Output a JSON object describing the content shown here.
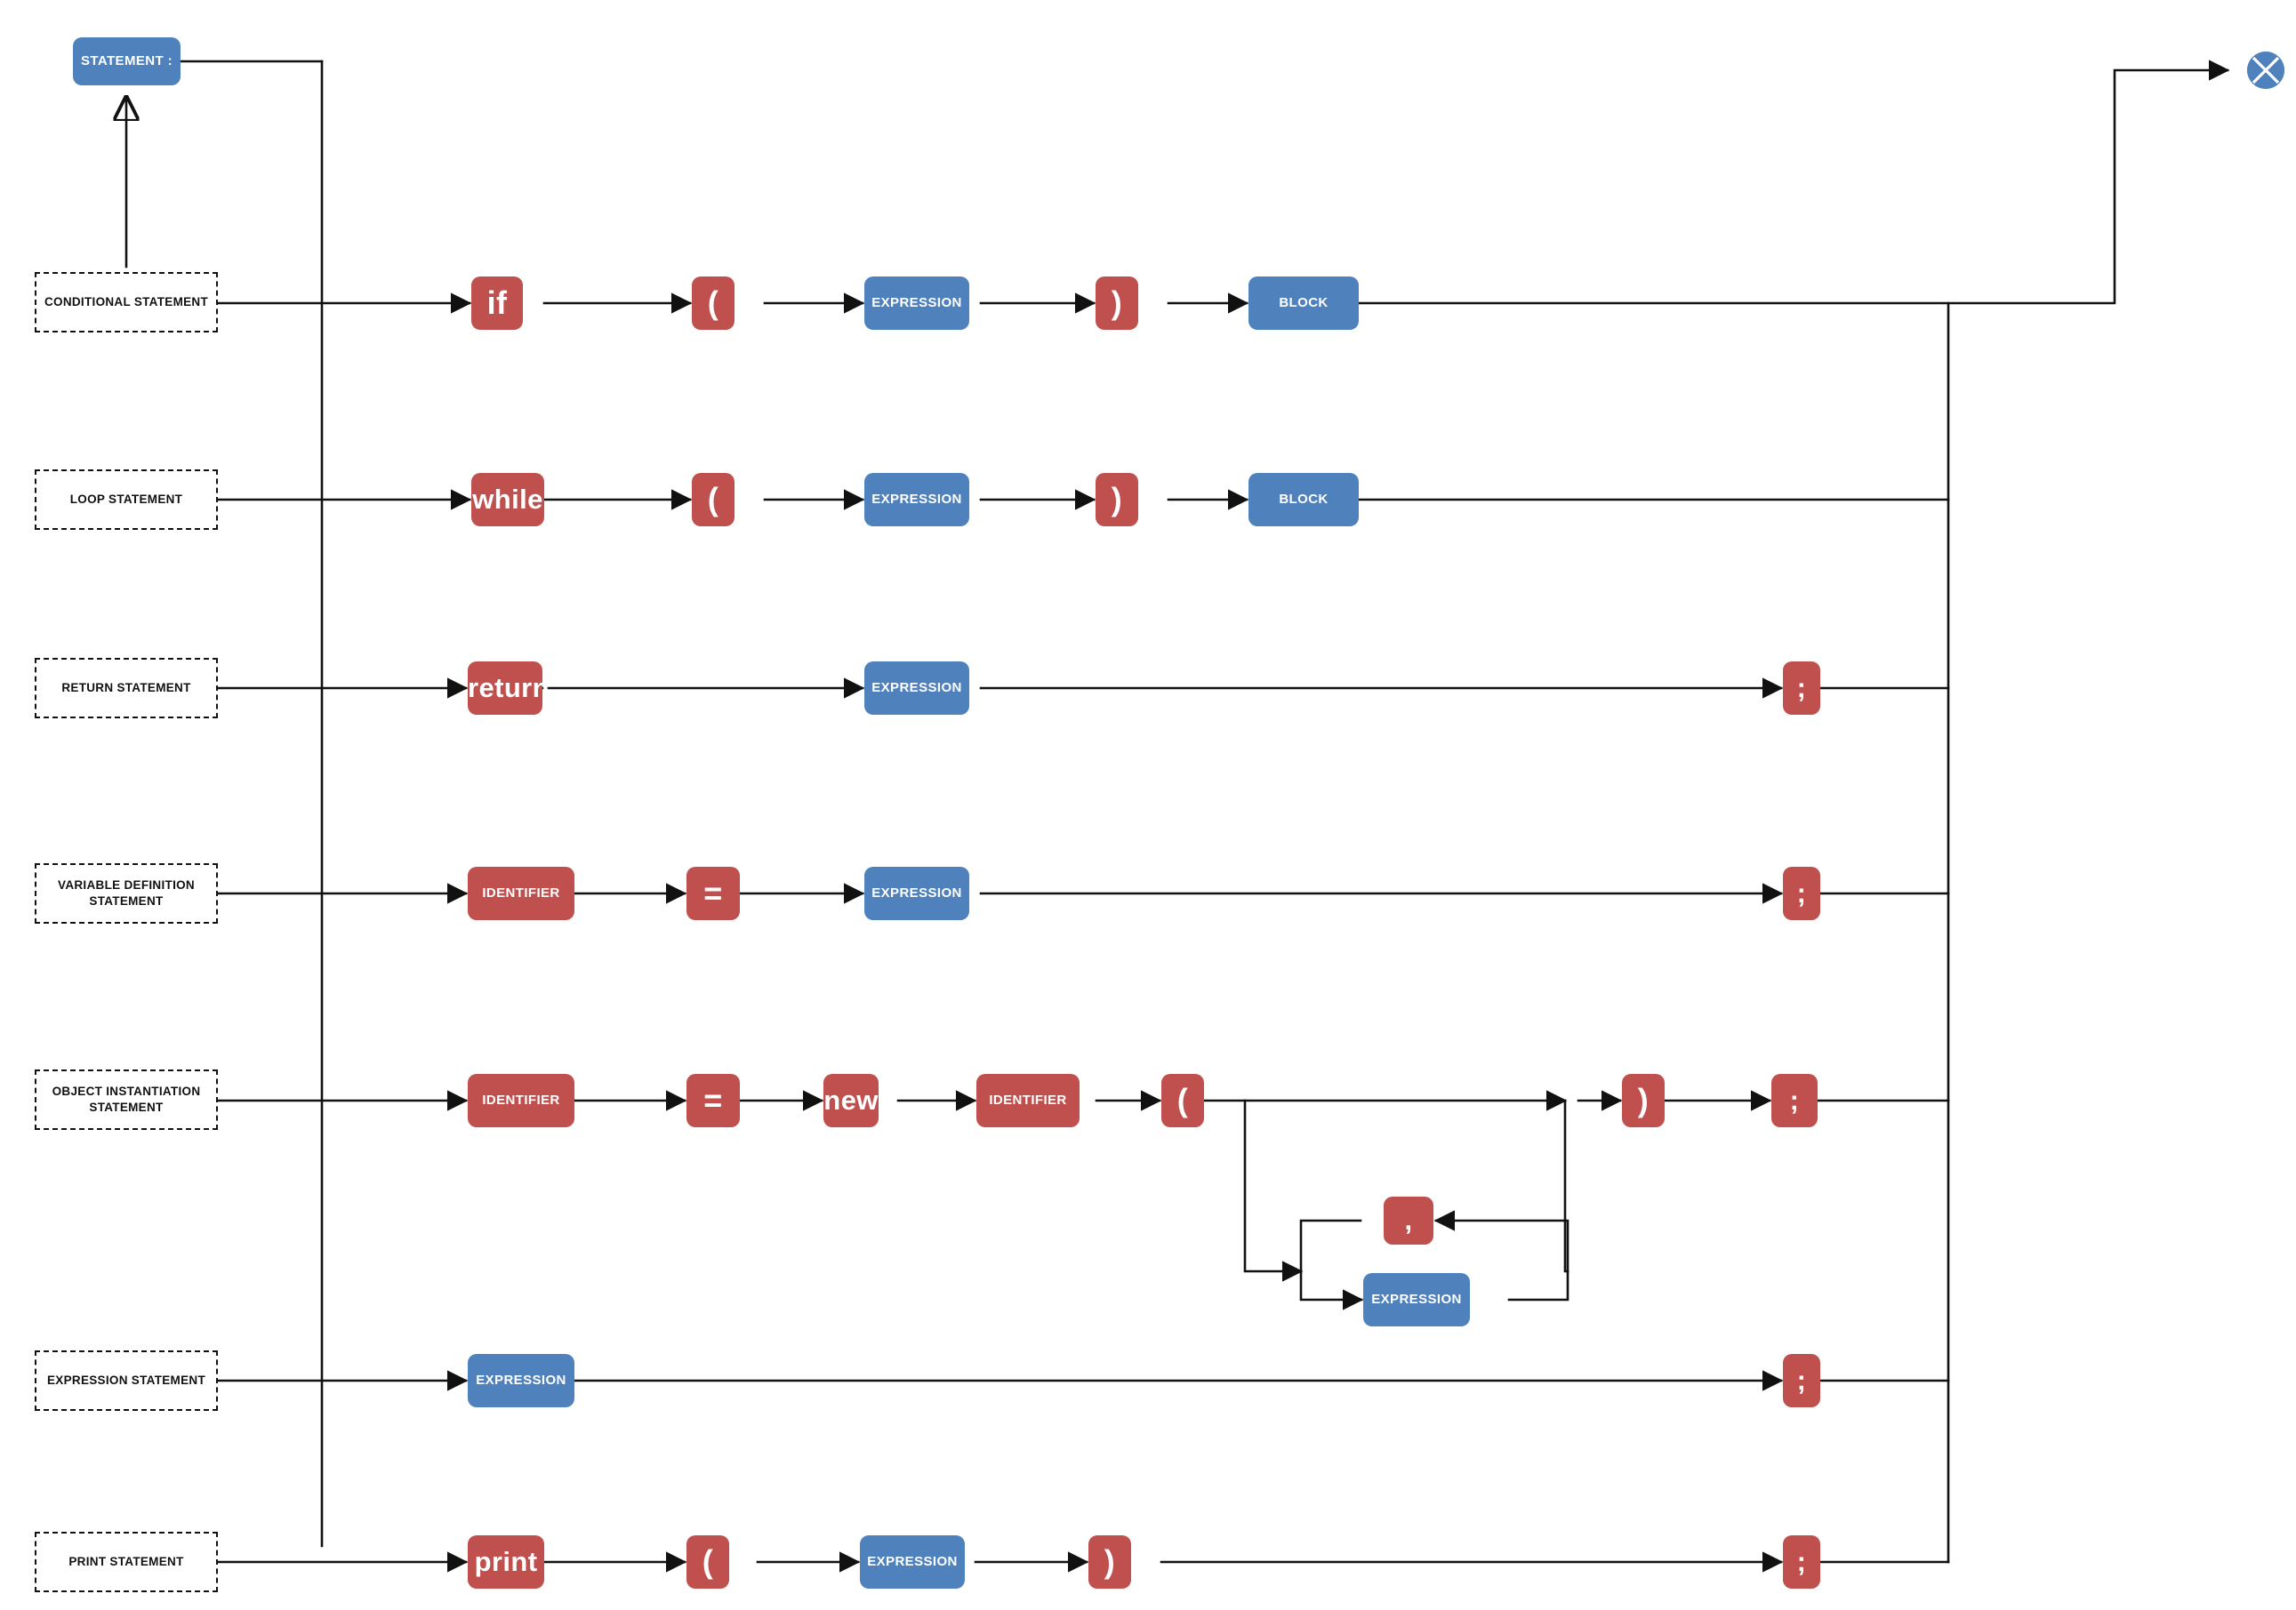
{
  "diagram": {
    "title": "STATEMENT :",
    "root_label": "STATEMENT :",
    "endpoint_icon": "circle-cross-icon",
    "colors": {
      "terminal": "#c0504d",
      "nonterminal": "#4f81bd",
      "line": "#111111",
      "group_border": "#111111",
      "background": "#ffffff"
    }
  },
  "alternatives": [
    {
      "name": "conditional-statement",
      "label": "CONDITIONAL STATEMENT",
      "sequence": [
        "if",
        "(",
        "EXPRESSION",
        ")",
        "BLOCK"
      ]
    },
    {
      "name": "loop-statement",
      "label": "LOOP STATEMENT",
      "sequence": [
        "while",
        "(",
        "EXPRESSION",
        ")",
        "BLOCK"
      ]
    },
    {
      "name": "return-statement",
      "label": "RETURN STATEMENT",
      "sequence": [
        "return",
        "EXPRESSION",
        ";"
      ]
    },
    {
      "name": "variable-definition-statement",
      "label": "VARIABLE DEFINITION\nSTATEMENT",
      "sequence": [
        "IDENTIFIER",
        "=",
        "EXPRESSION",
        ";"
      ]
    },
    {
      "name": "object-instantiation-statement",
      "label": "OBJECT INSTANTIATION\nSTATEMENT",
      "sequence": [
        "IDENTIFIER",
        "=",
        "new",
        "IDENTIFIER",
        "(",
        "EXPRESSION",
        ",",
        ")",
        ";"
      ]
    },
    {
      "name": "expression-statement",
      "label": "EXPRESSION STATEMENT",
      "sequence": [
        "EXPRESSION",
        ";"
      ]
    },
    {
      "name": "print-statement",
      "label": "PRINT STATEMENT",
      "sequence": [
        "print",
        "(",
        "EXPRESSION",
        ")",
        ";"
      ]
    }
  ],
  "nodes": {
    "root": {
      "text": "STATEMENT :",
      "kind": "nonterminal"
    },
    "cond_if": {
      "text": "if",
      "kind": "terminal"
    },
    "cond_lp": {
      "text": "(",
      "kind": "terminal"
    },
    "cond_expr": {
      "text": "EXPRESSION",
      "kind": "nonterminal"
    },
    "cond_rp": {
      "text": ")",
      "kind": "terminal"
    },
    "cond_block": {
      "text": "BLOCK",
      "kind": "nonterminal"
    },
    "loop_while": {
      "text": "while",
      "kind": "terminal"
    },
    "loop_lp": {
      "text": "(",
      "kind": "terminal"
    },
    "loop_expr": {
      "text": "EXPRESSION",
      "kind": "nonterminal"
    },
    "loop_rp": {
      "text": ")",
      "kind": "terminal"
    },
    "loop_block": {
      "text": "BLOCK",
      "kind": "nonterminal"
    },
    "ret_kw": {
      "text": "return",
      "kind": "terminal"
    },
    "ret_expr": {
      "text": "EXPRESSION",
      "kind": "nonterminal"
    },
    "ret_semi": {
      "text": ";",
      "kind": "terminal"
    },
    "var_id": {
      "text": "IDENTIFIER",
      "kind": "terminal"
    },
    "var_eq": {
      "text": "=",
      "kind": "terminal"
    },
    "var_expr": {
      "text": "EXPRESSION",
      "kind": "nonterminal"
    },
    "var_semi": {
      "text": ";",
      "kind": "terminal"
    },
    "obj_id": {
      "text": "IDENTIFIER",
      "kind": "terminal"
    },
    "obj_eq": {
      "text": "=",
      "kind": "terminal"
    },
    "obj_new": {
      "text": "new",
      "kind": "terminal"
    },
    "obj_id2": {
      "text": "IDENTIFIER",
      "kind": "terminal"
    },
    "obj_lp": {
      "text": "(",
      "kind": "terminal"
    },
    "obj_comma": {
      "text": ",",
      "kind": "terminal"
    },
    "obj_expr": {
      "text": "EXPRESSION",
      "kind": "nonterminal"
    },
    "obj_rp": {
      "text": ")",
      "kind": "terminal"
    },
    "obj_semi": {
      "text": ";",
      "kind": "terminal"
    },
    "exs_expr": {
      "text": "EXPRESSION",
      "kind": "nonterminal"
    },
    "exs_semi": {
      "text": ";",
      "kind": "terminal"
    },
    "prt_kw": {
      "text": "print",
      "kind": "terminal"
    },
    "prt_lp": {
      "text": "(",
      "kind": "terminal"
    },
    "prt_expr": {
      "text": "EXPRESSION",
      "kind": "nonterminal"
    },
    "prt_rp": {
      "text": ")",
      "kind": "terminal"
    },
    "prt_semi": {
      "text": ";",
      "kind": "terminal"
    }
  },
  "groups": {
    "g_cond": {
      "label": "CONDITIONAL STATEMENT"
    },
    "g_loop": {
      "label": "LOOP STATEMENT"
    },
    "g_ret": {
      "label": "RETURN STATEMENT"
    },
    "g_var": {
      "label": "VARIABLE DEFINITION\nSTATEMENT"
    },
    "g_obj": {
      "label": "OBJECT INSTANTIATION\nSTATEMENT"
    },
    "g_exs": {
      "label": "EXPRESSION STATEMENT"
    },
    "g_prt": {
      "label": "PRINT STATEMENT"
    }
  }
}
